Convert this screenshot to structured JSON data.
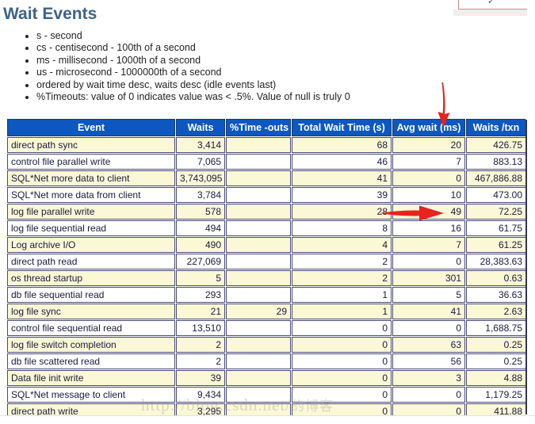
{
  "page": {
    "title": "Wait Events",
    "legend": [
      "s - second",
      "cs - centisecond - 100th of a second",
      "ms - millisecond - 1000th of a second",
      "us - microsecond - 1000000th of a second",
      "ordered by wait time desc, waits desc (idle events last)",
      "%Timeouts: value of 0 indicates value was < .5%. Value of null is truly 0"
    ],
    "watermark": "http://blog.csdn.net/",
    "watermark_cn": "的博客"
  },
  "topright": {
    "mark": "✓"
  },
  "annotations": [
    {
      "name": "arrow-down-avg-wait",
      "color": "#e8221c",
      "target": "Avg wait (ms) column header"
    },
    {
      "name": "arrow-right-log-file-parallel-write",
      "color": "#e8221c",
      "target": "49"
    }
  ],
  "table": {
    "headers": [
      "Event",
      "Waits",
      "%Time -outs",
      "Total Wait Time (s)",
      "Avg wait (ms)",
      "Waits /txn"
    ],
    "header_bg": "#0d57c1",
    "row_bg_odd": "#fbf8d6",
    "row_bg_even": "#ffffff",
    "rows": [
      {
        "event": "direct path sync",
        "waits": "3,414",
        "timeouts": "",
        "total_wait": "68",
        "avg_wait": "20",
        "waits_txn": "426.75"
      },
      {
        "event": "control file parallel write",
        "waits": "7,065",
        "timeouts": "",
        "total_wait": "46",
        "avg_wait": "7",
        "waits_txn": "883.13"
      },
      {
        "event": "SQL*Net more data to client",
        "waits": "3,743,095",
        "timeouts": "",
        "total_wait": "41",
        "avg_wait": "0",
        "waits_txn": "467,886.88"
      },
      {
        "event": "SQL*Net more data from client",
        "waits": "3,784",
        "timeouts": "",
        "total_wait": "39",
        "avg_wait": "10",
        "waits_txn": "473.00"
      },
      {
        "event": "log file parallel write",
        "waits": "578",
        "timeouts": "",
        "total_wait": "28",
        "avg_wait": "49",
        "waits_txn": "72.25"
      },
      {
        "event": "log file sequential read",
        "waits": "494",
        "timeouts": "",
        "total_wait": "8",
        "avg_wait": "16",
        "waits_txn": "61.75"
      },
      {
        "event": "Log archive I/O",
        "waits": "490",
        "timeouts": "",
        "total_wait": "4",
        "avg_wait": "7",
        "waits_txn": "61.25"
      },
      {
        "event": "direct path read",
        "waits": "227,069",
        "timeouts": "",
        "total_wait": "2",
        "avg_wait": "0",
        "waits_txn": "28,383.63"
      },
      {
        "event": "os thread startup",
        "waits": "5",
        "timeouts": "",
        "total_wait": "2",
        "avg_wait": "301",
        "waits_txn": "0.63"
      },
      {
        "event": "db file sequential read",
        "waits": "293",
        "timeouts": "",
        "total_wait": "1",
        "avg_wait": "5",
        "waits_txn": "36.63"
      },
      {
        "event": "log file sync",
        "waits": "21",
        "timeouts": "29",
        "total_wait": "1",
        "avg_wait": "41",
        "waits_txn": "2.63"
      },
      {
        "event": "control file sequential read",
        "waits": "13,510",
        "timeouts": "",
        "total_wait": "0",
        "avg_wait": "0",
        "waits_txn": "1,688.75"
      },
      {
        "event": "log file switch completion",
        "waits": "2",
        "timeouts": "",
        "total_wait": "0",
        "avg_wait": "63",
        "waits_txn": "0.25"
      },
      {
        "event": "db file scattered read",
        "waits": "2",
        "timeouts": "",
        "total_wait": "0",
        "avg_wait": "56",
        "waits_txn": "0.25"
      },
      {
        "event": "Data file init write",
        "waits": "39",
        "timeouts": "",
        "total_wait": "0",
        "avg_wait": "3",
        "waits_txn": "4.88"
      },
      {
        "event": "SQL*Net message to client",
        "waits": "9,434",
        "timeouts": "",
        "total_wait": "0",
        "avg_wait": "0",
        "waits_txn": "1,179.25"
      },
      {
        "event": "direct path write",
        "waits": "3,295",
        "timeouts": "",
        "total_wait": "0",
        "avg_wait": "0",
        "waits_txn": "411.88"
      }
    ]
  }
}
